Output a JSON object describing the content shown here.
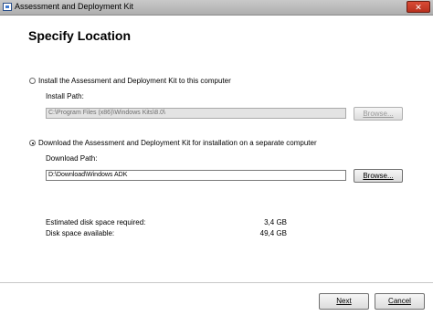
{
  "window": {
    "title": "Assessment and Deployment Kit",
    "close_symbol": "✕"
  },
  "page": {
    "title": "Specify Location"
  },
  "option_install": {
    "label": "Install the Assessment and Deployment Kit to this computer",
    "path_label": "Install Path:",
    "path_value": "C:\\Program Files (x86)\\Windows Kits\\8.0\\",
    "browse_label": "Browse...",
    "selected": false
  },
  "option_download": {
    "label": "Download the Assessment and Deployment Kit for installation on a separate computer",
    "path_label": "Download Path:",
    "path_value": "D:\\Download\\Windows ADK",
    "browse_label": "Browse...",
    "selected": true
  },
  "disk": {
    "required_label": "Estimated disk space required:",
    "required_value": "3,4 GB",
    "available_label": "Disk space available:",
    "available_value": "49,4 GB"
  },
  "footer": {
    "next_label": "Next",
    "cancel_label": "Cancel"
  }
}
